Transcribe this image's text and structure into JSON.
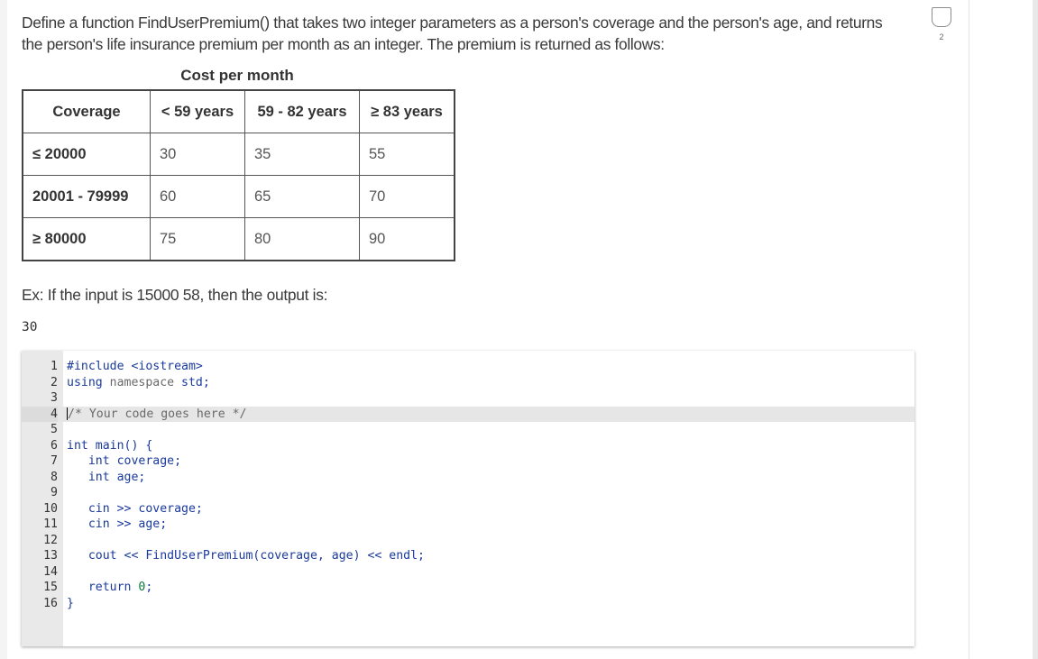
{
  "prompt": {
    "line1": "Define a function FindUserPremium() that takes two integer parameters as a person's coverage and the person's age, and returns",
    "line2": "the person's life insurance premium per month as an integer. The premium is returned as follows:"
  },
  "completion": {
    "count": "2"
  },
  "table": {
    "caption": "Cost per month",
    "headers": [
      "Coverage",
      "< 59 years",
      "59 - 82 years",
      "≥ 83 years"
    ],
    "rows": [
      [
        "≤ 20000",
        "30",
        "35",
        "55"
      ],
      [
        "20001 - 79999",
        "60",
        "65",
        "70"
      ],
      [
        "≥ 80000",
        "75",
        "80",
        "90"
      ]
    ]
  },
  "example": {
    "text": "Ex: If the input is 15000 58, then the output is:",
    "output": "30"
  },
  "editor": {
    "lines": [
      {
        "n": "1",
        "segs": [
          {
            "t": "#include <iostream>",
            "c": "kw"
          }
        ]
      },
      {
        "n": "2",
        "segs": [
          {
            "t": "using",
            "c": "kw"
          },
          {
            "t": " namespace ",
            "c": "mc"
          },
          {
            "t": "std;",
            "c": "kw"
          }
        ]
      },
      {
        "n": "3",
        "segs": []
      },
      {
        "n": "4",
        "segs": [
          {
            "t": "/* Your code goes here */",
            "c": "mc"
          }
        ],
        "active": true
      },
      {
        "n": "5",
        "segs": []
      },
      {
        "n": "6",
        "segs": [
          {
            "t": "int main() {",
            "c": "kw"
          }
        ]
      },
      {
        "n": "7",
        "segs": [
          {
            "t": "   int coverage;",
            "c": "kw"
          }
        ]
      },
      {
        "n": "8",
        "segs": [
          {
            "t": "   int age;",
            "c": "kw"
          }
        ]
      },
      {
        "n": "9",
        "segs": []
      },
      {
        "n": "10",
        "segs": [
          {
            "t": "   cin >> coverage;",
            "c": "kw"
          }
        ]
      },
      {
        "n": "11",
        "segs": [
          {
            "t": "   cin >> age;",
            "c": "kw"
          }
        ]
      },
      {
        "n": "12",
        "segs": []
      },
      {
        "n": "13",
        "segs": [
          {
            "t": "   cout << FindUserPremium(coverage, age) << endl;",
            "c": "kw"
          }
        ]
      },
      {
        "n": "14",
        "segs": []
      },
      {
        "n": "15",
        "segs": [
          {
            "t": "   return ",
            "c": "kw"
          },
          {
            "t": "0",
            "c": "num"
          },
          {
            "t": ";",
            "c": "kw"
          }
        ]
      },
      {
        "n": "16",
        "segs": [
          {
            "t": "}",
            "c": "kw"
          }
        ]
      }
    ]
  }
}
